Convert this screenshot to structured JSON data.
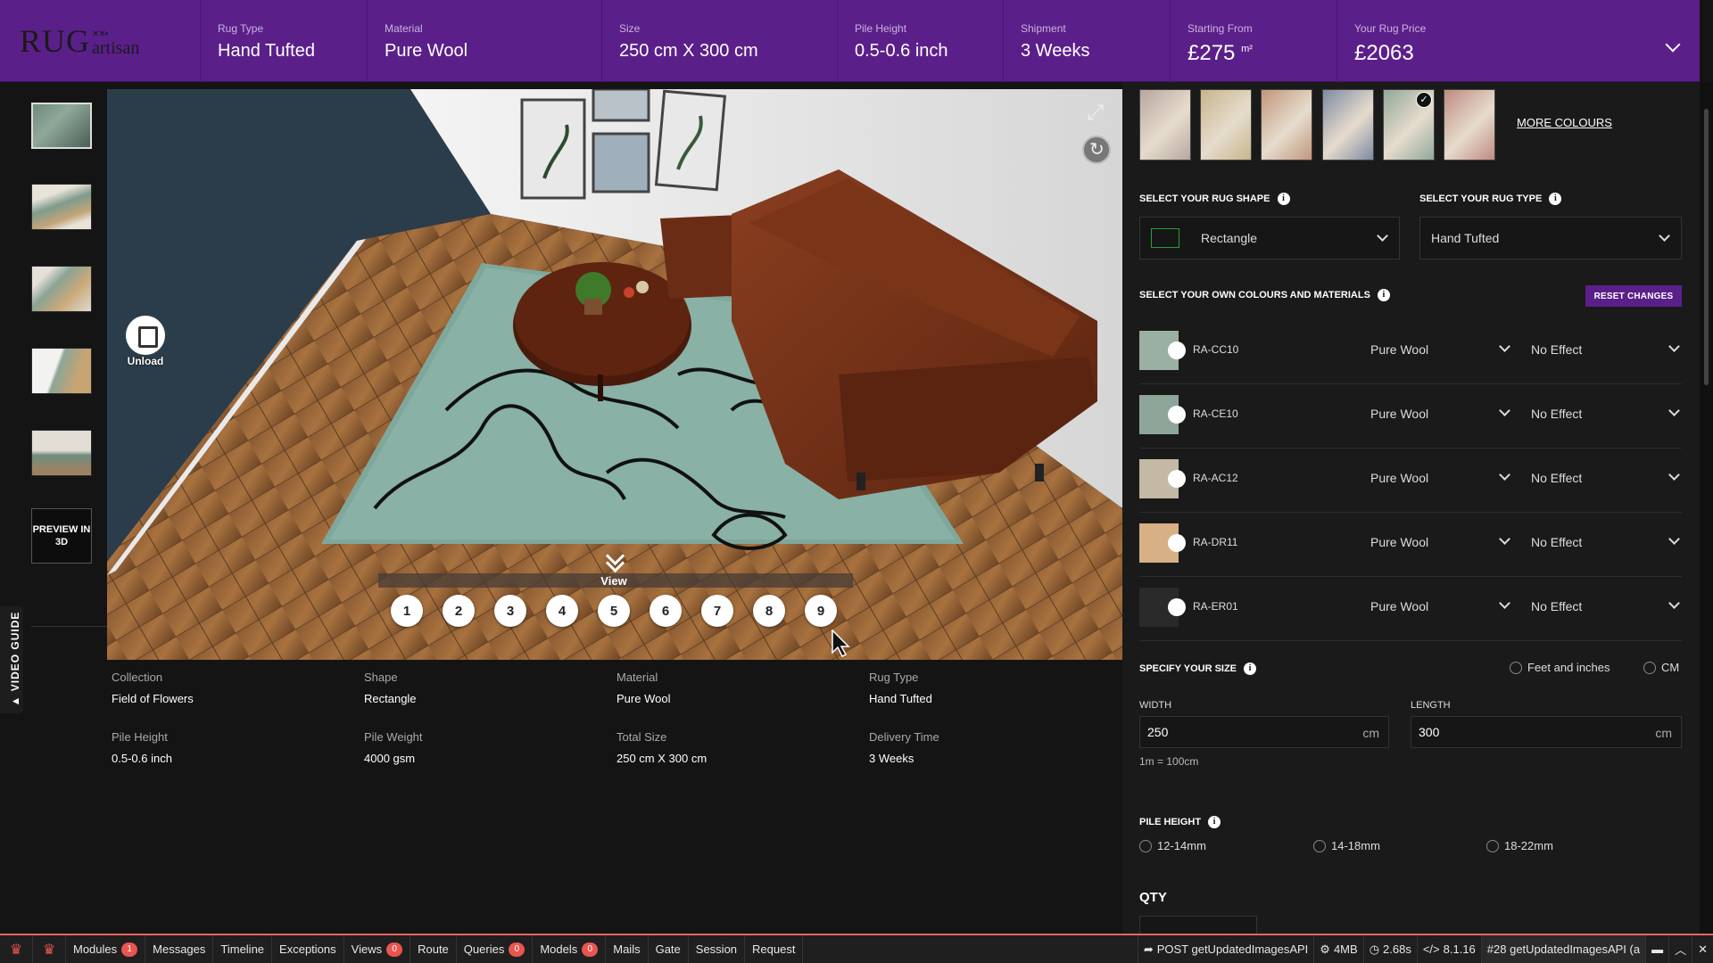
{
  "header": {
    "logo_main": "RUG",
    "logo_sub": "artisan",
    "cells": [
      {
        "label": "Rug Type",
        "value": "Hand Tufted"
      },
      {
        "label": "Material",
        "value": "Pure Wool"
      },
      {
        "label": "Size",
        "value": "250 cm X 300 cm"
      },
      {
        "label": "Pile Height",
        "value": "0.5-0.6 inch"
      },
      {
        "label": "Shipment",
        "value": "3 Weeks"
      },
      {
        "label": "Starting From",
        "value": "£275",
        "unit": "m²"
      },
      {
        "label": "Your Rug Price",
        "value": "£2063"
      }
    ]
  },
  "sidebar": {
    "preview_3d": "PREVIEW IN 3D",
    "video_guide": "▲ VIDEO GUIDE"
  },
  "viewer": {
    "unload_label": "Unload",
    "view_label": "View",
    "view_buttons": [
      "1",
      "2",
      "3",
      "4",
      "5",
      "6",
      "7",
      "8",
      "9"
    ]
  },
  "details": {
    "collection": {
      "label": "Collection",
      "value": "Field of Flowers"
    },
    "shape": {
      "label": "Shape",
      "value": "Rectangle"
    },
    "material": {
      "label": "Material",
      "value": "Pure Wool"
    },
    "rug_type": {
      "label": "Rug Type",
      "value": "Hand Tufted"
    },
    "pile_height": {
      "label": "Pile Height",
      "value": "0.5-0.6 inch"
    },
    "pile_weight": {
      "label": "Pile Weight",
      "value": "4000 gsm"
    },
    "total_size": {
      "label": "Total Size",
      "value": "250 cm X 300 cm"
    },
    "delivery_time": {
      "label": "Delivery Time",
      "value": "3 Weeks"
    }
  },
  "panel": {
    "more_colours": "MORE COLOURS",
    "swatch_colors": [
      "#b7a7a0",
      "#c7b58c",
      "#c1977c",
      "#7f8aa3",
      "#93a89a",
      "#c08a80"
    ],
    "shape_title": "SELECT YOUR RUG SHAPE",
    "shape_value": "Rectangle",
    "type_title": "SELECT YOUR RUG TYPE",
    "type_value": "Hand Tufted",
    "colours_title": "SELECT YOUR OWN COLOURS AND MATERIALS",
    "reset_label": "RESET CHANGES",
    "color_rows": [
      {
        "code": "RA-CC10",
        "color": "#9ab0a2",
        "material": "Pure Wool",
        "effect": "No Effect"
      },
      {
        "code": "RA-CE10",
        "color": "#8ea69a",
        "material": "Pure Wool",
        "effect": "No Effect"
      },
      {
        "code": "RA-AC12",
        "color": "#c4b9a4",
        "material": "Pure Wool",
        "effect": "No Effect"
      },
      {
        "code": "RA-DR11",
        "color": "#d7b085",
        "material": "Pure Wool",
        "effect": "No Effect"
      },
      {
        "code": "RA-ER01",
        "color": "#2a2a2a",
        "material": "Pure Wool",
        "effect": "No Effect"
      }
    ],
    "size_title": "SPECIFY YOUR SIZE",
    "unit_options": [
      "Feet and inches",
      "CM"
    ],
    "width_label": "WIDTH",
    "width_value": "250",
    "length_label": "LENGTH",
    "length_value": "300",
    "unit_cm": "cm",
    "conversion_note": "1m = 100cm",
    "pile_title": "PILE HEIGHT",
    "pile_options": [
      "12-14mm",
      "14-18mm",
      "18-22mm"
    ],
    "qty_title": "QTY"
  },
  "debugbar": {
    "items": [
      {
        "label": "Modules",
        "badge": "1"
      },
      {
        "label": "Messages"
      },
      {
        "label": "Timeline"
      },
      {
        "label": "Exceptions"
      },
      {
        "label": "Views",
        "badge": "0"
      },
      {
        "label": "Route"
      },
      {
        "label": "Queries",
        "badge": "0"
      },
      {
        "label": "Models",
        "badge": "0"
      },
      {
        "label": "Mails"
      },
      {
        "label": "Gate"
      },
      {
        "label": "Session"
      },
      {
        "label": "Request"
      }
    ],
    "request": "POST getUpdatedImagesAPI",
    "memory": "4MB",
    "time": "2.68s",
    "php_version": "8.1.16",
    "request_select": "#28 getUpdatedImagesAPI (a"
  }
}
